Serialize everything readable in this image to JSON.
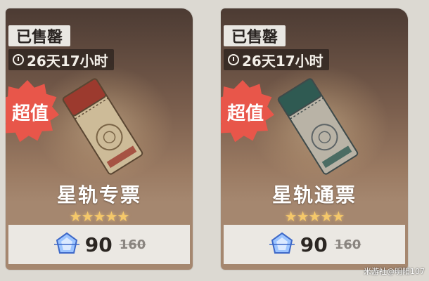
{
  "cards": [
    {
      "sold_label": "已售罄",
      "timer_text": "26天17小时",
      "value_badge": "超值",
      "title": "星轨专票",
      "stars": "★★★★★",
      "price": "90",
      "original_price": "160",
      "ticket_accent": "#9c3a2e",
      "timer_icon": "clock-icon",
      "currency_icon": "stellar-jade-icon"
    },
    {
      "sold_label": "已售罄",
      "timer_text": "26天17小时",
      "value_badge": "超值",
      "title": "星轨通票",
      "stars": "★★★★★",
      "price": "90",
      "original_price": "160",
      "ticket_accent": "#2f5a52",
      "timer_icon": "clock-icon",
      "currency_icon": "stellar-jade-icon"
    }
  ],
  "watermark": "米游社@明阳107",
  "colors": {
    "background": "#dcd9d2",
    "value_badge": "#e8564a",
    "star": "#f5c86a"
  }
}
